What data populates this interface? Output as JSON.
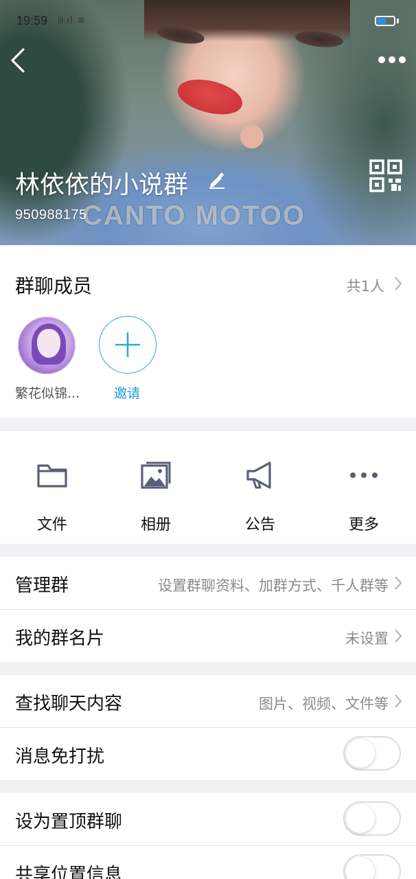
{
  "status_bar": {
    "time": "19:59",
    "signal": "⊪ıl ≋"
  },
  "header": {
    "group_name": "林依依的小说群",
    "group_id": "950988175",
    "watermark": "CANTO MOTOO"
  },
  "members": {
    "title": "群聊成员",
    "count": "共1人",
    "list": [
      {
        "name": "繁花似锦..."
      }
    ],
    "invite_label": "邀请"
  },
  "tools": [
    {
      "label": "文件",
      "icon": "folder-icon"
    },
    {
      "label": "相册",
      "icon": "photo-album-icon"
    },
    {
      "label": "公告",
      "icon": "megaphone-icon"
    },
    {
      "label": "更多",
      "icon": "more-dots-icon"
    }
  ],
  "settings": {
    "manage": {
      "label": "管理群",
      "value": "设置群聊资料、加群方式、千人群等"
    },
    "card": {
      "label": "我的群名片",
      "value": "未设置"
    },
    "search": {
      "label": "查找聊天内容",
      "value": "图片、视频、文件等"
    },
    "mute": {
      "label": "消息免打扰",
      "on": false
    },
    "pin": {
      "label": "设为置顶群聊",
      "on": false
    },
    "location": {
      "label": "共享位置信息",
      "on": false
    }
  },
  "colors": {
    "accent": "#1f9ad8",
    "battery": "#2f8fe8"
  },
  "battery_level": 0.55
}
